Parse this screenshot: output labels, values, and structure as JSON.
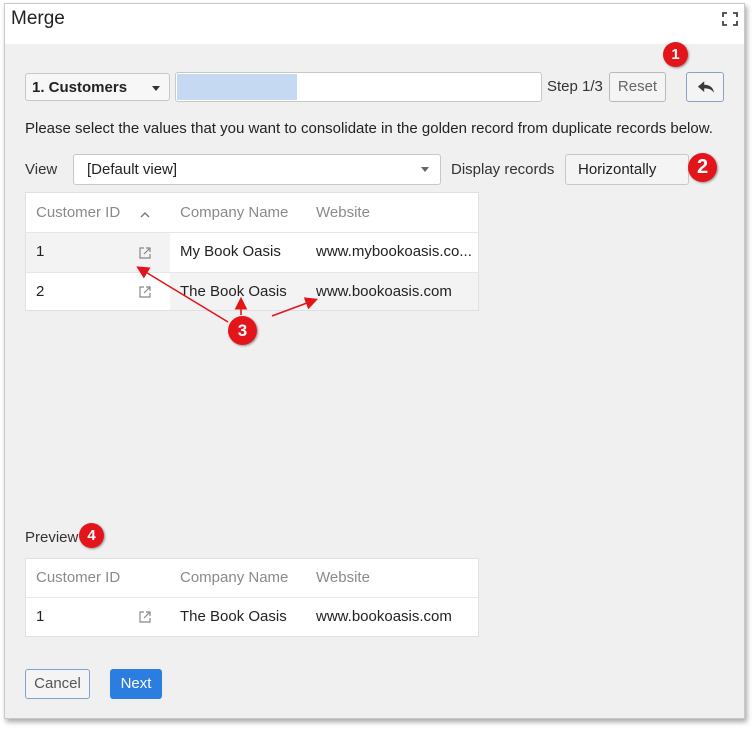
{
  "dialog": {
    "title": "Merge",
    "maximize_icon": "maximize-icon"
  },
  "toolbar": {
    "entity_select": "1. Customers",
    "progress": 0.33,
    "step_label": "Step 1/3",
    "reset_label": "Reset",
    "back_icon": "reply-arrow-icon"
  },
  "instruction": "Please select the values that you want to consolidate in the golden record from duplicate records below.",
  "view": {
    "label": "View",
    "value": "[Default view]",
    "display_label": "Display records",
    "display_value": "Horizontally"
  },
  "records_table": {
    "columns": [
      "Customer ID",
      "Company Name",
      "Website"
    ],
    "rows": [
      {
        "id": "1",
        "company": "My Book Oasis",
        "website": "www.mybookoasis.co..."
      },
      {
        "id": "2",
        "company": "The Book Oasis",
        "website": "www.bookoasis.com"
      }
    ]
  },
  "preview": {
    "label": "Preview",
    "columns": [
      "Customer ID",
      "Company Name",
      "Website"
    ],
    "rows": [
      {
        "id": "1",
        "company": "The Book Oasis",
        "website": "www.bookoasis.com"
      }
    ]
  },
  "footer": {
    "cancel_label": "Cancel",
    "next_label": "Next"
  },
  "annotations": {
    "badge1": "1",
    "badge2": "2",
    "badge3": "3",
    "badge4": "4",
    "color": "#e4141b"
  }
}
